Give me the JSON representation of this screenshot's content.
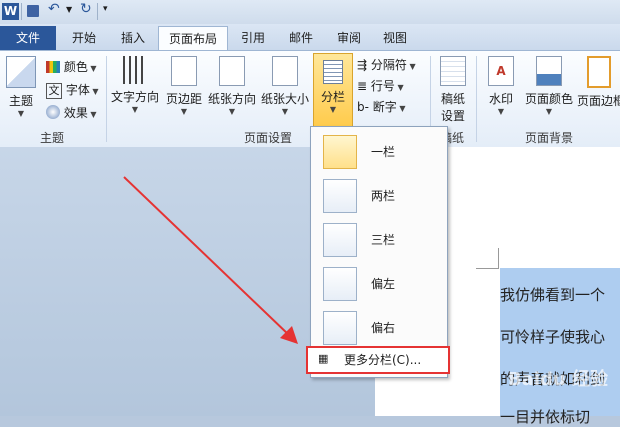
{
  "qat": {
    "word_icon": "word-logo",
    "save": "save-icon",
    "undo": "undo-icon",
    "redo": "redo-icon"
  },
  "tabs": [
    {
      "label": "文件"
    },
    {
      "label": "开始"
    },
    {
      "label": "插入"
    },
    {
      "label": "页面布局"
    },
    {
      "label": "引用"
    },
    {
      "label": "邮件"
    },
    {
      "label": "审阅"
    },
    {
      "label": "视图"
    }
  ],
  "ribbon": {
    "theme": {
      "label": "主题",
      "colors": "颜色",
      "fonts": "字体",
      "effects": "效果",
      "group": "主题",
      "font_glyph": "文"
    },
    "page_setup": {
      "text_direction": "文字方向",
      "margins": "页边距",
      "orientation": "纸张方向",
      "size": "纸张大小",
      "columns": "分栏",
      "breaks": "分隔符",
      "line_numbers": "行号",
      "hyphenation": "断字",
      "group": "页面设置"
    },
    "draft": {
      "label_line1": "稿纸",
      "label_line2": "设置",
      "group": "稿纸"
    },
    "background": {
      "watermark": "水印",
      "page_color": "页面颜色",
      "page_border": "页面边框",
      "group": "页面背景"
    }
  },
  "columns_menu": {
    "items": [
      "一栏",
      "两栏",
      "三栏",
      "偏左",
      "偏右"
    ],
    "more": "更多分栏(C)..."
  },
  "document": {
    "lines": [
      "我仿佛看到一个",
      "可怜样子使我心",
      "的声音就如利剑",
      "一目并依标切"
    ]
  },
  "watermark_text": "Baidu 经验",
  "colors": {
    "file_tab": "#2b579a",
    "accent": "#e53333",
    "selection": "#aecdf0"
  }
}
